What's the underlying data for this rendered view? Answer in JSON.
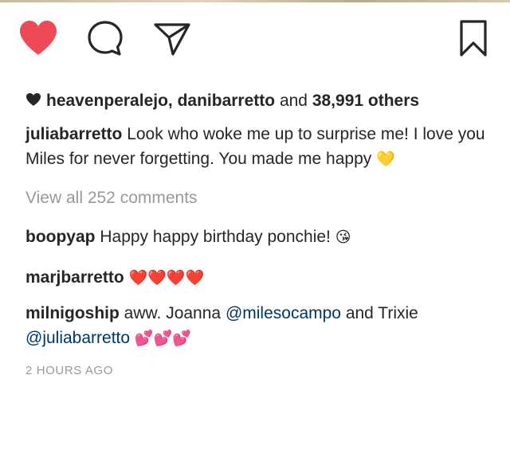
{
  "actions": {
    "like_icon": "heart-filled-icon",
    "comment_icon": "comment-bubble-icon",
    "share_icon": "paper-plane-icon",
    "save_icon": "bookmark-icon",
    "like_color": "#ed4956"
  },
  "likes": {
    "users": "heavenperalejo, danibarretto",
    "and_word": "and",
    "count": "38,991",
    "others_word": "others"
  },
  "caption": {
    "username": "juliabarretto",
    "text": "Look who woke me up to surprise me! I love you Miles for never forgetting. You made me happy",
    "emoji": "💛"
  },
  "view_all": "View all 252 comments",
  "comments": [
    {
      "username": "boopyap",
      "text": "Happy happy birthday ponchie!",
      "emoji": "😘"
    },
    {
      "username": "marjbarretto",
      "emoji": "❤️❤️❤️❤️"
    },
    {
      "username": "milnigoship",
      "text_before": "aww. Joanna",
      "mention1": "@milesocampo",
      "text_middle": "and Trixie",
      "mention2": "@juliabarretto",
      "emoji": "💕💕💕"
    }
  ],
  "timestamp": "2 HOURS AGO",
  "colors": {
    "text": "#262626",
    "muted": "#999999",
    "mention": "#003569"
  }
}
